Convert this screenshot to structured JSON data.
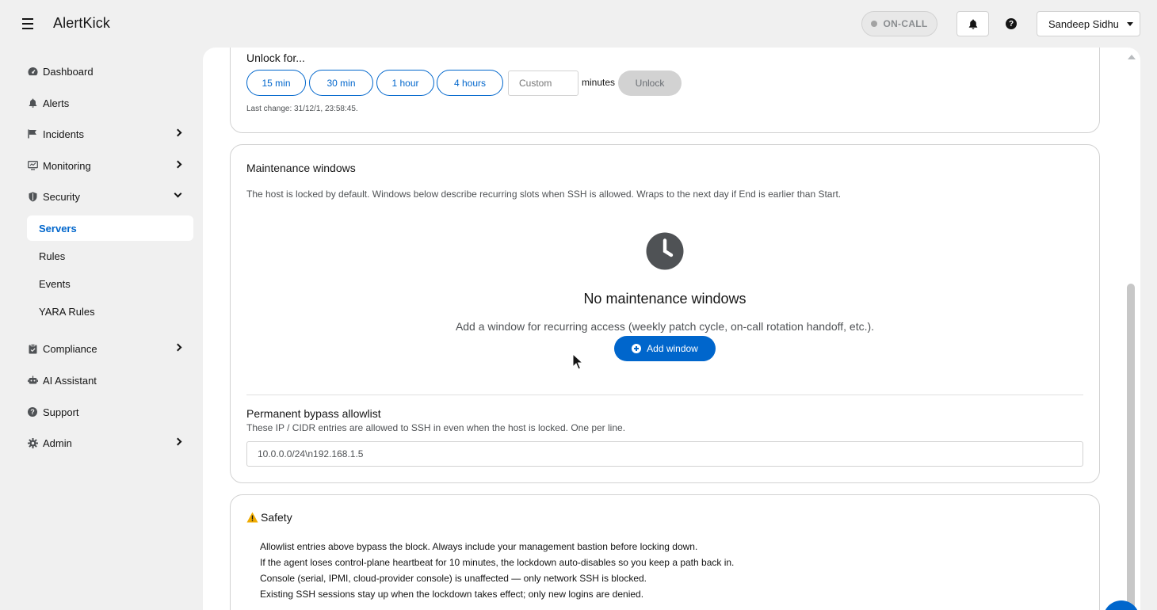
{
  "app": {
    "brand": "AlertKick"
  },
  "header": {
    "oncall_label": "ON-CALL",
    "user_name": "Sandeep Sidhu"
  },
  "sidebar": {
    "items": [
      {
        "label": "Dashboard",
        "icon": "dashboard-icon"
      },
      {
        "label": "Alerts",
        "icon": "bell-icon"
      },
      {
        "label": "Incidents",
        "icon": "flag-icon",
        "expandable": true
      },
      {
        "label": "Monitoring",
        "icon": "monitor-icon",
        "expandable": true
      },
      {
        "label": "Security",
        "icon": "shield-icon",
        "expanded": true
      },
      {
        "label": "Compliance",
        "icon": "clipboard-icon",
        "expandable": true
      },
      {
        "label": "AI Assistant",
        "icon": "robot-icon"
      },
      {
        "label": "Support",
        "icon": "help-icon"
      },
      {
        "label": "Admin",
        "icon": "gear-icon",
        "expandable": true
      }
    ],
    "security_sub": [
      {
        "label": "Servers",
        "active": true
      },
      {
        "label": "Rules"
      },
      {
        "label": "Events"
      },
      {
        "label": "YARA Rules"
      }
    ]
  },
  "unlock": {
    "title": "Unlock for...",
    "options": [
      "15 min",
      "30 min",
      "1 hour",
      "4 hours"
    ],
    "custom_placeholder": "Custom",
    "minutes_label": "minutes",
    "unlock_button": "Unlock",
    "last_change": "Last change: 31/12/1, 23:58:45."
  },
  "maintenance": {
    "title": "Maintenance windows",
    "description": "The host is locked by default. Windows below describe recurring slots when SSH is allowed. Wraps to the next day if End is earlier than Start.",
    "empty_title": "No maintenance windows",
    "empty_description": "Add a window for recurring access (weekly patch cycle, on-call rotation handoff, etc.).",
    "add_button": "Add window"
  },
  "bypass": {
    "title": "Permanent bypass allowlist",
    "description": "These IP / CIDR entries are allowed to SSH in even when the host is locked. One per line.",
    "value": "10.0.0.0/24\\n192.168.1.5"
  },
  "safety": {
    "title": "Safety",
    "lines": [
      "Allowlist entries above bypass the block. Always include your management bastion before locking down.",
      "If the agent loses control-plane heartbeat for 10 minutes, the lockdown auto-disables so you keep a path back in.",
      "Console (serial, IPMI, cloud-provider console) is unaffected — only network SSH is blocked.",
      "Existing SSH sessions stay up when the lockdown takes effect; only new logins are denied."
    ]
  },
  "colors": {
    "accent": "#0066cc",
    "warning": "#f0ab00",
    "active_bg": "#ffffff"
  }
}
